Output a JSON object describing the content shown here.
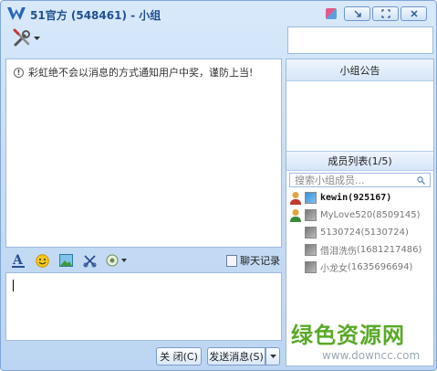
{
  "window": {
    "title": "51官方 (548461) - 小组",
    "controls": [
      "minimize-icon",
      "maximize-icon",
      "close-icon"
    ]
  },
  "toolbar": {
    "settings_icon": "tools-icon"
  },
  "chat": {
    "notice_text": "彩虹绝不会以消息的方式通知用户中奖，谨防上当!"
  },
  "format_bar": {
    "icons": [
      "font-icon",
      "emoticon-icon",
      "picture-icon",
      "screenshot-icon",
      "more-tools-icon"
    ],
    "history_label": "聊天记录"
  },
  "input": {
    "value": ""
  },
  "buttons": {
    "close_label": "关 闭(C)",
    "send_label": "发送消息(S)",
    "send_options_icon": "chevron-down-icon"
  },
  "side": {
    "announcement_title": "小组公告",
    "members_title": "成员列表(1/5)",
    "search_placeholder": "搜索小组成员...",
    "members": [
      {
        "name": "kewin",
        "id": "(925167)",
        "online": true,
        "role": "admin"
      },
      {
        "name": "MyLove520",
        "id": "(8509145)",
        "online": false,
        "role": "admin"
      },
      {
        "name": "5130724",
        "id": "(5130724)",
        "online": false,
        "role": ""
      },
      {
        "name": "借泪洗伤",
        "id": "(1681217486)",
        "online": false,
        "role": ""
      },
      {
        "name": "小龙女",
        "id": "(1635696694)",
        "online": false,
        "role": ""
      }
    ]
  },
  "watermark": {
    "cn": "绿色资源网",
    "url": "www.downcc.com"
  },
  "colors": {
    "accent": "#1f4f8f",
    "watermark_green": "#5aa928"
  }
}
